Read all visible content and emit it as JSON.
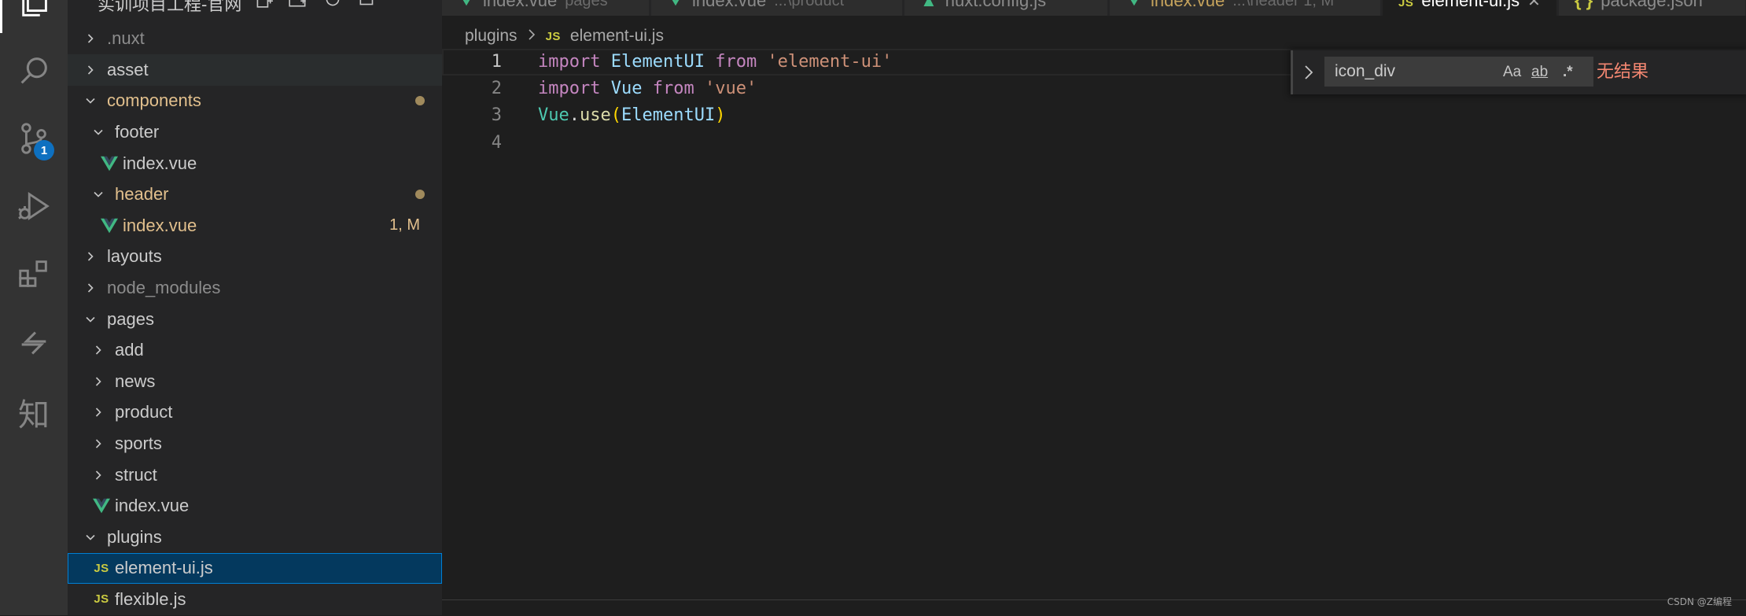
{
  "explorer": {
    "title": "实训项目工程-官网",
    "items": [
      {
        "label": ".nuxt",
        "kind": "folder",
        "expanded": false,
        "depth": 0,
        "muted": true
      },
      {
        "label": "asset",
        "kind": "folder",
        "expanded": false,
        "depth": 0
      },
      {
        "label": "components",
        "kind": "folder",
        "expanded": true,
        "depth": 0,
        "modified": true
      },
      {
        "label": "footer",
        "kind": "folder",
        "expanded": true,
        "depth": 1
      },
      {
        "label": "index.vue",
        "kind": "vue",
        "depth": 2
      },
      {
        "label": "header",
        "kind": "folder",
        "expanded": true,
        "depth": 1,
        "modified": true
      },
      {
        "label": "index.vue",
        "kind": "vue",
        "depth": 2,
        "modified": true,
        "status": "1, M"
      },
      {
        "label": "layouts",
        "kind": "folder",
        "expanded": false,
        "depth": 0
      },
      {
        "label": "node_modules",
        "kind": "folder",
        "expanded": false,
        "depth": 0,
        "muted": true
      },
      {
        "label": "pages",
        "kind": "folder",
        "expanded": true,
        "depth": 0
      },
      {
        "label": "add",
        "kind": "folder",
        "expanded": false,
        "depth": 1
      },
      {
        "label": "news",
        "kind": "folder",
        "expanded": false,
        "depth": 1
      },
      {
        "label": "product",
        "kind": "folder",
        "expanded": false,
        "depth": 1
      },
      {
        "label": "sports",
        "kind": "folder",
        "expanded": false,
        "depth": 1
      },
      {
        "label": "struct",
        "kind": "folder",
        "expanded": false,
        "depth": 1
      },
      {
        "label": "index.vue",
        "kind": "vue",
        "depth": 1
      },
      {
        "label": "plugins",
        "kind": "folder",
        "expanded": true,
        "depth": 0
      },
      {
        "label": "element-ui.js",
        "kind": "js",
        "depth": 1,
        "selected": true
      },
      {
        "label": "flexible.js",
        "kind": "js",
        "depth": 1
      }
    ]
  },
  "activity_bar": {
    "icons": [
      "explorer-icon",
      "search-icon",
      "source-control-icon",
      "run-debug-icon",
      "extensions-icon",
      "remote-icon",
      "zhi-icon"
    ],
    "source_control_badge": "1",
    "zhi_glyph": "知"
  },
  "tabs": [
    {
      "label": "index.vue",
      "desc": "pages",
      "icon": "vue"
    },
    {
      "label": "index.vue",
      "desc": "...\\product",
      "icon": "vue"
    },
    {
      "label": "nuxt.config.js",
      "desc": "",
      "icon": "nuxt"
    },
    {
      "label": "index.vue",
      "desc": "...\\header 1, M",
      "icon": "vue",
      "modified": true
    },
    {
      "label": "element-ui.js",
      "desc": "",
      "icon": "js",
      "active": true
    },
    {
      "label": "package.json",
      "desc": "",
      "icon": "json"
    }
  ],
  "breadcrumb": {
    "folder": "plugins",
    "file_badge": "JS",
    "file": "element-ui.js"
  },
  "editor": {
    "current_line": 1,
    "lines": [
      {
        "num": "1",
        "tokens": [
          [
            "kw",
            "import"
          ],
          [
            "pn",
            " "
          ],
          [
            "id",
            "ElementUI"
          ],
          [
            "pn",
            " "
          ],
          [
            "kw",
            "from"
          ],
          [
            "pn",
            " "
          ],
          [
            "str",
            "'element-ui'"
          ]
        ]
      },
      {
        "num": "2",
        "tokens": [
          [
            "kw",
            "import"
          ],
          [
            "pn",
            " "
          ],
          [
            "id",
            "Vue"
          ],
          [
            "pn",
            " "
          ],
          [
            "kw",
            "from"
          ],
          [
            "pn",
            " "
          ],
          [
            "str",
            "'vue'"
          ]
        ]
      },
      {
        "num": "3",
        "tokens": [
          [
            "cls",
            "Vue"
          ],
          [
            "pn",
            "."
          ],
          [
            "fn",
            "use"
          ],
          [
            "br",
            "("
          ],
          [
            "id",
            "ElementUI"
          ],
          [
            "br",
            ")"
          ]
        ]
      },
      {
        "num": "4",
        "tokens": []
      }
    ]
  },
  "find_widget": {
    "query": "icon_div",
    "match_case_label": "Aa",
    "whole_word_label": "ab",
    "regex_label": ".*",
    "result": "无结果"
  },
  "watermark": "CSDN @Z编程",
  "colors": {
    "accent": "#007fd4",
    "modified": "#e2c08d",
    "no_result": "#f48771",
    "badge": "#0e70c0"
  }
}
